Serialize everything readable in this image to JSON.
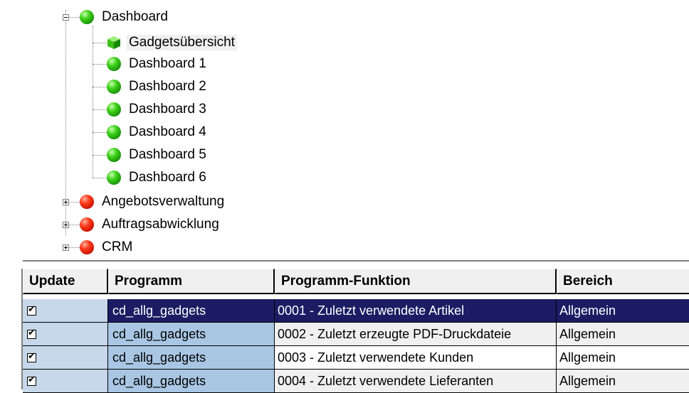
{
  "tree": {
    "dashboard": {
      "label": "Dashboard",
      "expanded": true,
      "icon": "green-ball-icon",
      "children": [
        {
          "label": "Gadgetsübersicht",
          "icon": "green-cube-icon",
          "selected": true
        },
        {
          "label": "Dashboard 1",
          "icon": "green-ball-icon"
        },
        {
          "label": "Dashboard 2",
          "icon": "green-ball-icon"
        },
        {
          "label": "Dashboard 3",
          "icon": "green-ball-icon"
        },
        {
          "label": "Dashboard 4",
          "icon": "green-ball-icon"
        },
        {
          "label": "Dashboard 5",
          "icon": "green-ball-icon"
        },
        {
          "label": "Dashboard 6",
          "icon": "green-ball-icon"
        }
      ]
    },
    "collapsed": [
      {
        "label": "Angebotsverwaltung",
        "icon": "red-ball-icon"
      },
      {
        "label": "Auftragsabwicklung",
        "icon": "red-ball-icon"
      },
      {
        "label": "CRM",
        "icon": "red-ball-icon"
      }
    ]
  },
  "grid": {
    "columns": [
      "Update",
      "Programm",
      "Programm-Funktion",
      "Bereich"
    ],
    "rows": [
      {
        "update": true,
        "programm": "cd_allg_gadgets",
        "funktion": "0001 - Zuletzt verwendete Artikel",
        "bereich": "Allgemein",
        "selected": true
      },
      {
        "update": true,
        "programm": "cd_allg_gadgets",
        "funktion": "0002 - Zuletzt erzeugte PDF-Druckdateie",
        "bereich": "Allgemein"
      },
      {
        "update": true,
        "programm": "cd_allg_gadgets",
        "funktion": "0003 - Zuletzt verwendete Kunden",
        "bereich": "Allgemein"
      },
      {
        "update": true,
        "programm": "cd_allg_gadgets",
        "funktion": "0004 - Zuletzt verwendete Lieferanten",
        "bereich": "Allgemein"
      }
    ]
  },
  "colors": {
    "selected_row": "#1b1c63",
    "programm_col": "#a9c7e4",
    "update_col": "#c6d8ea"
  }
}
